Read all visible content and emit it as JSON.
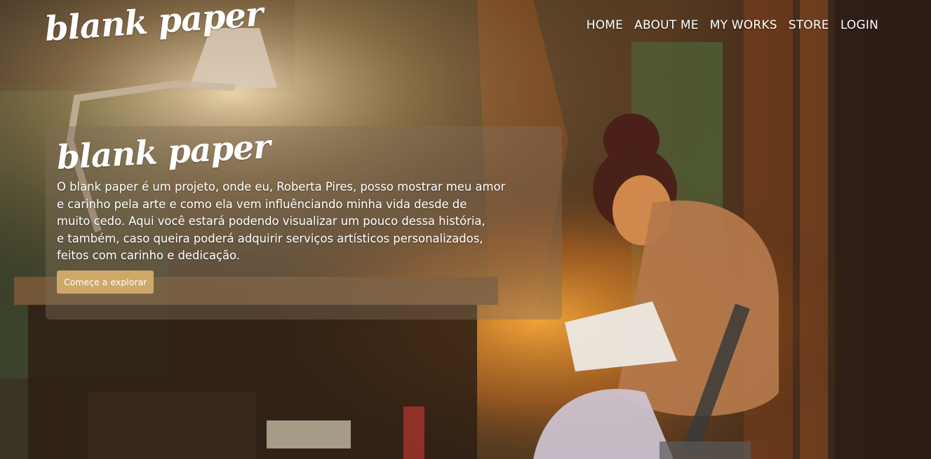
{
  "header": {
    "logo_text": "blank paper",
    "nav": [
      {
        "label": "HOME"
      },
      {
        "label": "ABOUT ME"
      },
      {
        "label": "MY WORKS"
      },
      {
        "label": "STORE"
      },
      {
        "label": "LOGIN"
      }
    ]
  },
  "hero": {
    "title": "blank paper",
    "description": "O blank paper é um projeto, onde eu, Roberta Pires, posso mostrar meu amor\ne carinho pela arte e como ela vem influênciando minha vida desde de\nmuito cedo. Aqui você estará podendo visualizar um pouco dessa história,\ne também, caso queira poderá adquirir serviços artísticos personalizados,\nfeitos com carinho e dedicação.",
    "cta_label": "Começe a explorar"
  },
  "colors": {
    "accent": "#cda869",
    "text": "#ffffff",
    "card_overlay": "rgba(128,110,90,0.42)"
  }
}
